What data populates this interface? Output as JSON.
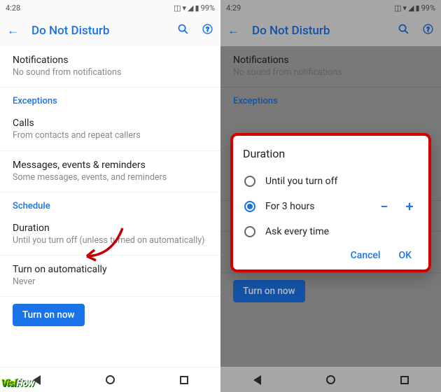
{
  "status": {
    "time_left": "4:28",
    "time_right": "4:29",
    "battery": "99%"
  },
  "titlebar": {
    "title": "Do Not Disturb"
  },
  "rows": {
    "notifications": {
      "title": "Notifications",
      "sub": "No sound from notifications"
    },
    "calls": {
      "title": "Calls",
      "sub": "From contacts and repeat callers"
    },
    "messages": {
      "title": "Messages, events & reminders",
      "sub": "Some messages, events, and reminders"
    },
    "duration": {
      "title": "Duration",
      "sub": "Until you turn off (unless turned on automatically)"
    },
    "auto": {
      "title": "Turn on automatically",
      "sub": "Never"
    }
  },
  "sections": {
    "exceptions": "Exceptions",
    "schedule": "Schedule"
  },
  "button": {
    "turn_on": "Turn on now"
  },
  "dialog": {
    "title": "Duration",
    "opt_until": "Until you turn off",
    "opt_hours": "For 3 hours",
    "opt_ask": "Ask every time",
    "minus": "−",
    "plus": "+",
    "cancel": "Cancel",
    "ok": "OK"
  },
  "rows_r": {
    "duration_sub": "automatically)"
  },
  "watermark": {
    "visi": "Visi",
    "how": "How"
  }
}
